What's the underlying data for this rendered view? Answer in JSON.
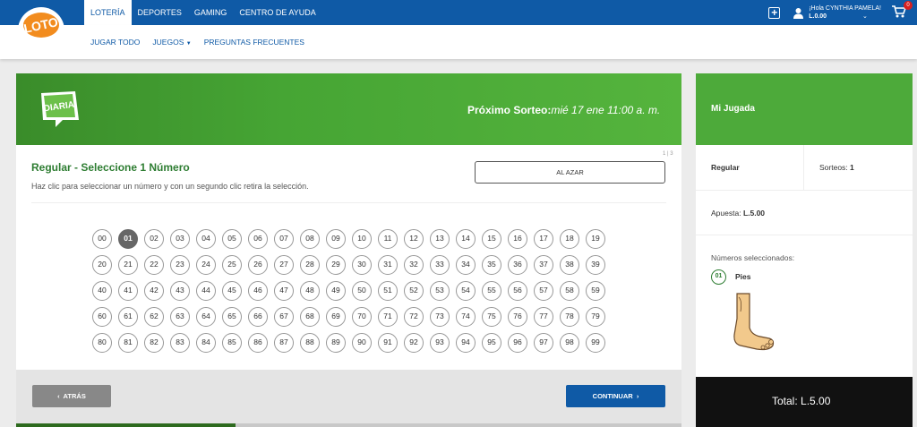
{
  "nav": {
    "top_items": [
      "LOTERÍA",
      "DEPORTES",
      "GAMING",
      "CENTRO DE AYUDA"
    ],
    "sub_items": [
      "JUGAR TODO",
      "JUEGOS",
      "PREGUNTAS FRECUENTES"
    ],
    "greeting": "¡Hola CYNTHIA PAMELA!",
    "balance": "L.0.00",
    "cart_count": "0"
  },
  "logo_text": "LOTO",
  "banner": {
    "game_logo_text": "DIARIA",
    "next_draw_label": "Próximo Sorteo:",
    "next_draw_value": "mié 17 ene 11:00 a. m."
  },
  "pager": "1 | 3",
  "selection": {
    "title": "Regular - Seleccione 1 Número",
    "subtitle": "Haz clic para seleccionar un número y con un segundo clic retira la selección.",
    "random_button": "AL AZAR",
    "numbers": [
      "00",
      "01",
      "02",
      "03",
      "04",
      "05",
      "06",
      "07",
      "08",
      "09",
      "10",
      "11",
      "12",
      "13",
      "14",
      "15",
      "16",
      "17",
      "18",
      "19",
      "20",
      "21",
      "22",
      "23",
      "24",
      "25",
      "26",
      "27",
      "28",
      "29",
      "30",
      "31",
      "32",
      "33",
      "34",
      "35",
      "36",
      "37",
      "38",
      "39",
      "40",
      "41",
      "42",
      "43",
      "44",
      "45",
      "46",
      "47",
      "48",
      "49",
      "50",
      "51",
      "52",
      "53",
      "54",
      "55",
      "56",
      "57",
      "58",
      "59",
      "60",
      "61",
      "62",
      "63",
      "64",
      "65",
      "66",
      "67",
      "68",
      "69",
      "70",
      "71",
      "72",
      "73",
      "74",
      "75",
      "76",
      "77",
      "78",
      "79",
      "80",
      "81",
      "82",
      "83",
      "84",
      "85",
      "86",
      "87",
      "88",
      "89",
      "90",
      "91",
      "92",
      "93",
      "94",
      "95",
      "96",
      "97",
      "98",
      "99"
    ],
    "selected": "01"
  },
  "actions": {
    "back": "ATRÁS",
    "next": "CONTINUAR"
  },
  "progress_fraction": 0.33,
  "side": {
    "title": "Mi Jugada",
    "mode": "Regular",
    "draws_label": "Sorteos:",
    "draws_value": "1",
    "bet_label": "Apuesta:",
    "bet_value": "L.5.00",
    "selected_label": "Números seleccionados:",
    "selected_number": "01",
    "selected_name": "Pies",
    "total": "Total: L.5.00"
  },
  "colors": {
    "brand_blue": "#0f5aa6",
    "brand_green": "#4daa3a",
    "dark_green": "#2e7d32"
  }
}
